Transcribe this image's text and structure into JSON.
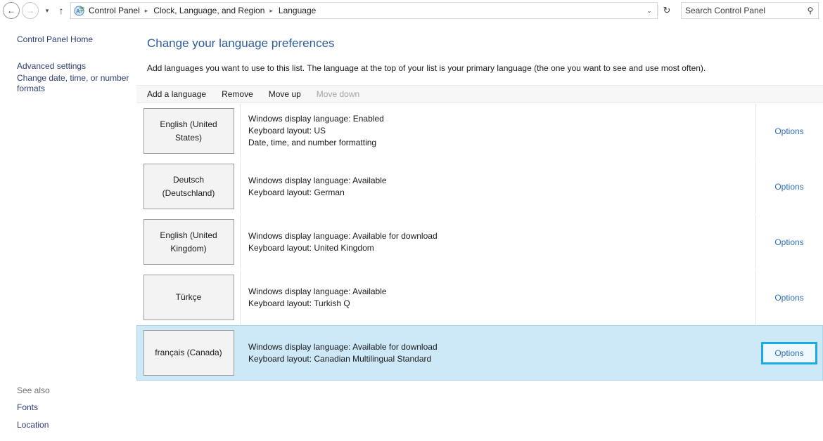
{
  "window": {
    "nav": {
      "back_icon": "back-arrow-icon",
      "back_glyph": "←",
      "forward_icon": "forward-arrow-icon",
      "forward_glyph": "→",
      "history_caret_glyph": "▾",
      "up_glyph": "↑"
    },
    "breadcrumb": {
      "icon": "language-control-panel-icon",
      "separator": "▸",
      "items": [
        {
          "label": "Control Panel"
        },
        {
          "label": "Clock, Language, and Region"
        },
        {
          "label": "Language"
        }
      ],
      "dropdown_glyph": "⌄",
      "refresh_glyph": "↻"
    },
    "search": {
      "placeholder": "Search Control Panel",
      "value": "",
      "icon_glyph": "⚲"
    }
  },
  "sidebar": {
    "items": [
      {
        "label": "Control Panel Home"
      },
      {
        "label": "Advanced settings"
      },
      {
        "label": "Change date, time, or number formats"
      }
    ],
    "see_also": {
      "label": "See also",
      "items": [
        {
          "label": "Fonts"
        },
        {
          "label": "Location"
        }
      ]
    }
  },
  "main": {
    "title": "Change your language preferences",
    "description": "Add languages you want to use to this list. The language at the top of your list is your primary language (the one you want to see and use most often).",
    "toolbar": {
      "add_label": "Add a language",
      "remove_label": "Remove",
      "move_up_label": "Move up",
      "move_down_label": "Move down",
      "move_down_disabled": true
    },
    "options_label": "Options",
    "languages": [
      {
        "name": "English (United States)",
        "details": [
          "Windows display language: Enabled",
          "Keyboard layout: US",
          "Date, time, and number formatting"
        ],
        "options_label": "Options",
        "selected": false
      },
      {
        "name": "Deutsch (Deutschland)",
        "details": [
          "Windows display language: Available",
          "Keyboard layout: German"
        ],
        "options_label": "Options",
        "selected": false
      },
      {
        "name": "English (United Kingdom)",
        "details": [
          "Windows display language: Available for download",
          "Keyboard layout: United Kingdom"
        ],
        "options_label": "Options",
        "selected": false
      },
      {
        "name": "Türkçe",
        "details": [
          "Windows display language: Available",
          "Keyboard layout: Turkish Q"
        ],
        "options_label": "Options",
        "selected": false
      },
      {
        "name": "français (Canada)",
        "details": [
          "Windows display language: Available for download",
          "Keyboard layout: Canadian Multilingual Standard"
        ],
        "options_label": "Options",
        "selected": true,
        "options_highlighted": true
      }
    ]
  },
  "colors": {
    "selected_row_bg": "#cde8f7",
    "highlight_border": "#17ade4",
    "link_blue": "#2c3e73",
    "title_blue": "#2e5c9a",
    "options_blue": "#2e6fb7"
  }
}
